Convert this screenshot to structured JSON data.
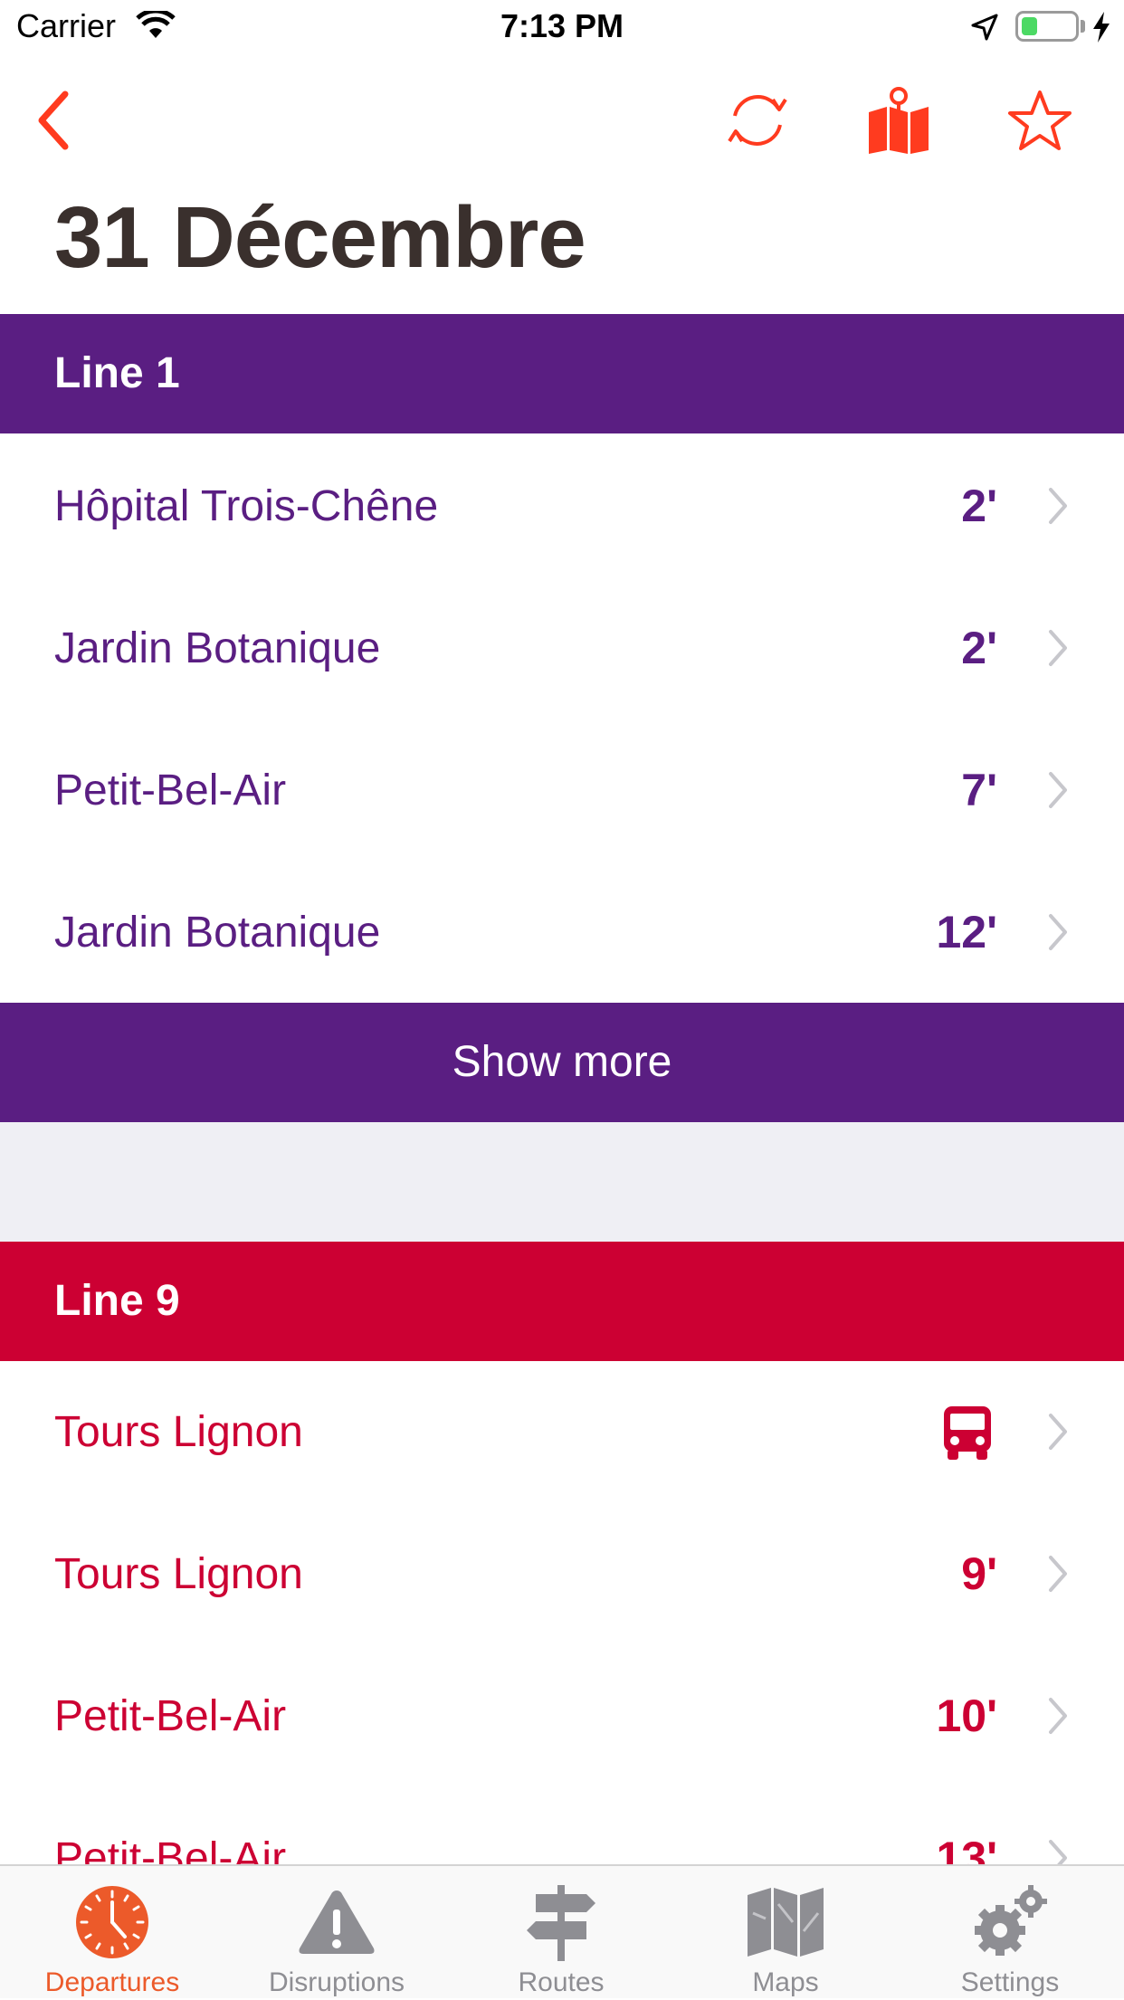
{
  "status_bar": {
    "carrier": "Carrier",
    "time": "7:13 PM",
    "battery_level": 0.3
  },
  "nav": {
    "back_icon": "chevron-left-icon",
    "refresh_icon": "refresh-icon",
    "map_icon": "map-pin-icon",
    "favorite_icon": "star-icon",
    "accent_color": "#ff3b1f"
  },
  "title": "31 Décembre",
  "sections": [
    {
      "line_name": "Line 1",
      "color": "#5a1e82",
      "departures": [
        {
          "destination": "Hôpital Trois-Chêne",
          "time": "2'"
        },
        {
          "destination": "Jardin Botanique",
          "time": "2'"
        },
        {
          "destination": "Petit-Bel-Air",
          "time": "7'"
        },
        {
          "destination": "Jardin Botanique",
          "time": "12'"
        }
      ],
      "show_more_label": "Show more"
    },
    {
      "line_name": "Line 9",
      "color": "#cc0033",
      "departures": [
        {
          "destination": "Tours Lignon",
          "time": "",
          "icon": "bus-icon"
        },
        {
          "destination": "Tours Lignon",
          "time": "9'"
        },
        {
          "destination": "Petit-Bel-Air",
          "time": "10'"
        },
        {
          "destination": "Petit-Bel-Air",
          "time": "13'"
        }
      ]
    }
  ],
  "tabbar": {
    "active_color": "#ec5a2a",
    "tabs": [
      {
        "label": "Departures",
        "icon": "clock-icon",
        "active": true
      },
      {
        "label": "Disruptions",
        "icon": "warning-icon",
        "active": false
      },
      {
        "label": "Routes",
        "icon": "signpost-icon",
        "active": false
      },
      {
        "label": "Maps",
        "icon": "map-icon",
        "active": false
      },
      {
        "label": "Settings",
        "icon": "gears-icon",
        "active": false
      }
    ]
  }
}
